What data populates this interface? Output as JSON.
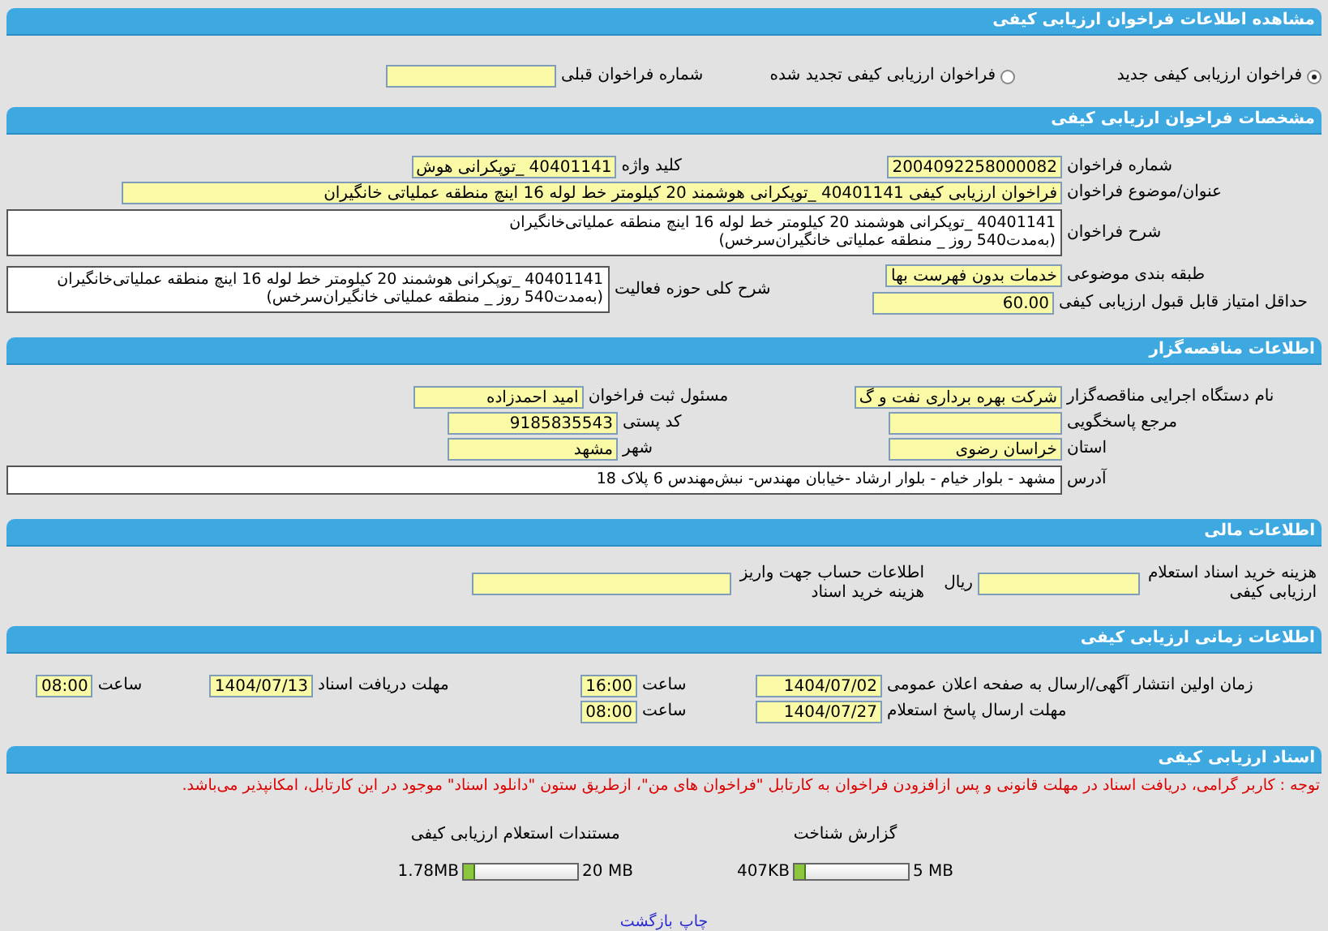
{
  "page_title": "مشاهده اطلاعات فراخوان ارزیابی کیفی",
  "call_type": {
    "options": [
      {
        "label": "فراخوان ارزیابی کیفی جدید",
        "selected": true
      },
      {
        "label": "فراخوان ارزیابی کیفی تجدید شده",
        "selected": false
      }
    ],
    "previous_call": {
      "label": "شماره فراخوان قبلی"
    }
  },
  "details": {
    "title": "مشخصات فراخوان ارزیابی کیفی",
    "number": {
      "label": "شماره فراخوان",
      "value": "2004092258000082"
    },
    "keyword": {
      "label": "کلید واژه",
      "value": "40401141 _توپکرانی هوش"
    },
    "subject": {
      "label": "عنوان/موضوع فراخوان",
      "value": "فراخوان ارزیابی کیفی 40401141 _توپکرانی هوشمند 20 کیلومتر خط لوله 16 اینچ منطقه عملیاتی خانگیران"
    },
    "description": {
      "label": "شرح فراخوان",
      "value": "40401141 _توپکرانی هوشمند 20 کیلومتر خط لوله 16 اینچ منطقه عملیاتی‌خانگیران\n(به‌مدت540 روز _ منطقه عملیاتی خانگیران‌سرخس)"
    },
    "category": {
      "label": "طبقه بندی موضوعی",
      "value": "خدمات بدون فهرست بها"
    },
    "min_score": {
      "label": "حداقل امتیاز قابل قبول ارزیابی کیفی",
      "value": "60.00"
    },
    "activity": {
      "label": "شرح کلی حوزه فعالیت",
      "value": "40401141 _توپکرانی هوشمند 20 کیلومتر خط لوله 16 اینچ منطقه عملیاتی‌خانگیران\n(به‌مدت540 روز _ منطقه عملیاتی خانگیران‌سرخس)"
    }
  },
  "tenderer": {
    "title": "اطلاعات مناقصه‌گزار",
    "rows": [
      [
        {
          "label": "نام دستگاه اجرایی مناقصه‌گزار",
          "value": "شرکت بهره برداری نفت و گ"
        },
        {
          "label": "مسئول ثبت فراخوان",
          "value": "امید احمدزاده"
        }
      ],
      [
        {
          "label": "مرجع پاسخگویی"
        },
        {
          "label": "کد پستی",
          "value": "9185835543"
        }
      ],
      [
        {
          "label": "استان",
          "value": "خراسان رضوی"
        },
        {
          "label": "شهر",
          "value": "مشهد"
        }
      ]
    ],
    "address": {
      "label": "آدرس",
      "value": "مشهد - بلوار خیام - بلوار ارشاد -خیابان مهندس- نبش‌مهندس 6 پلاک 18"
    }
  },
  "financial": {
    "title": "اطلاعات مالی",
    "fee": {
      "label": "هزینه خرید اسناد استعلام ارزیابی کیفی",
      "unit": "ریال"
    },
    "account": {
      "label": "اطلاعات حساب جهت واریز هزینه خرید اسناد"
    }
  },
  "schedule": {
    "title": "اطلاعات زمانی ارزیابی کیفی",
    "rows": [
      [
        {
          "label": "زمان اولین انتشار آگهی/ارسال به صفحه اعلان عمومی",
          "date": "1404/07/02",
          "time_label": "ساعت",
          "time": "16:00"
        },
        {
          "label": "مهلت دریافت اسناد",
          "date": "1404/07/13",
          "time_label": "ساعت",
          "time": "08:00"
        }
      ],
      [
        {
          "label": "مهلت ارسال پاسخ استعلام",
          "date": "1404/07/27",
          "time_label": "ساعت",
          "time": "08:00"
        }
      ]
    ]
  },
  "documents": {
    "title": "اسناد ارزیابی کیفی",
    "notice": "توجه : کاربر گرامی، دریافت اسناد در مهلت قانونی و پس ازافزودن فراخوان به کارتابل \"فراخوان های من\"، ازطریق ستون \"دانلود اسناد\" موجود در این کارتابل، امکانپذیر می‌باشد.",
    "items": [
      {
        "title": "گزارش شناخت",
        "max": "5 MB",
        "size": "407KB",
        "level": 0.08
      },
      {
        "title": "مستندات استعلام ارزیابی کیفی",
        "max": "20 MB",
        "size": "1.78MB",
        "level": 0.09
      }
    ]
  },
  "links": [
    "چاپ",
    "بازگشت"
  ]
}
